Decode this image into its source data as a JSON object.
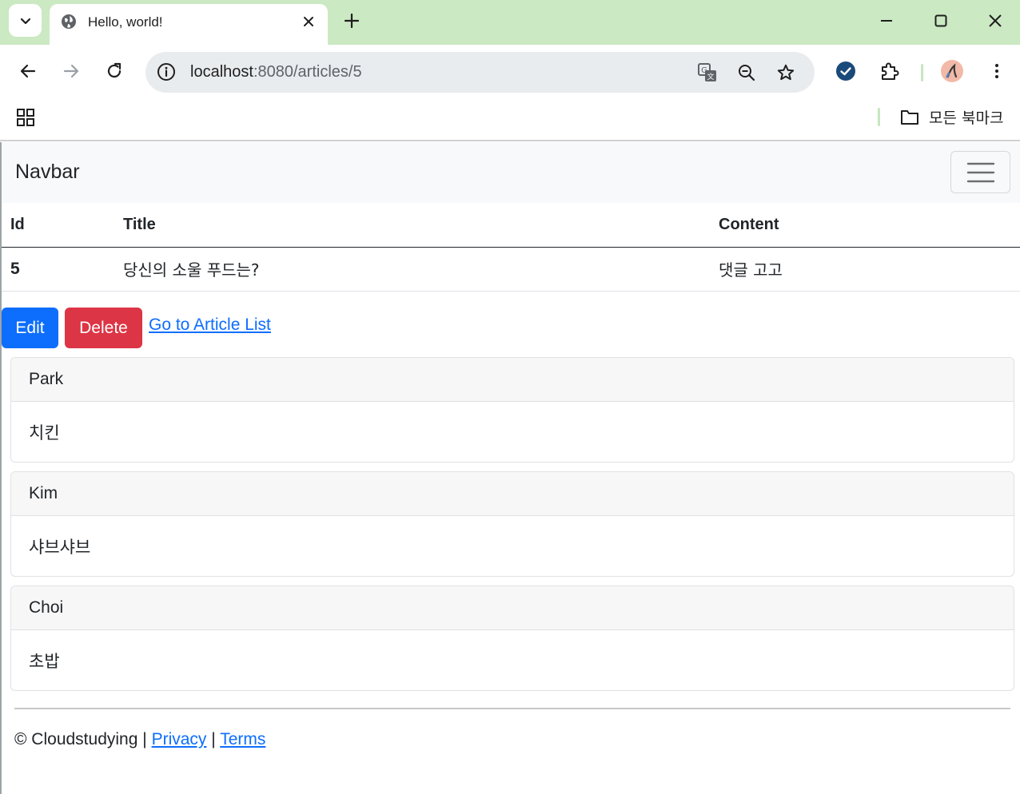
{
  "browser": {
    "tab_title": "Hello, world!",
    "url_host": "localhost",
    "url_rest": ":8080/articles/5",
    "bookmarks_label": "모든 북마크",
    "accent_color": "#cbe9c2"
  },
  "navbar": {
    "brand": "Navbar"
  },
  "article_table": {
    "headers": [
      "Id",
      "Title",
      "Content"
    ],
    "rows": [
      {
        "id": "5",
        "title": "당신의 소울 푸드는?",
        "content": "댓글 고고"
      }
    ]
  },
  "actions": {
    "edit_label": "Edit",
    "delete_label": "Delete",
    "list_link_label": "Go to Article List"
  },
  "comments": [
    {
      "nickname": "Park",
      "body": "치킨"
    },
    {
      "nickname": "Kim",
      "body": "샤브샤브"
    },
    {
      "nickname": "Choi",
      "body": "초밥"
    }
  ],
  "footer": {
    "copyright": "© Cloudstudying",
    "separator": "|",
    "privacy_label": "Privacy",
    "terms_label": "Terms"
  },
  "colors": {
    "primary": "#0d6efd",
    "danger": "#dc3545",
    "navbar_bg": "#f8f9fa"
  }
}
